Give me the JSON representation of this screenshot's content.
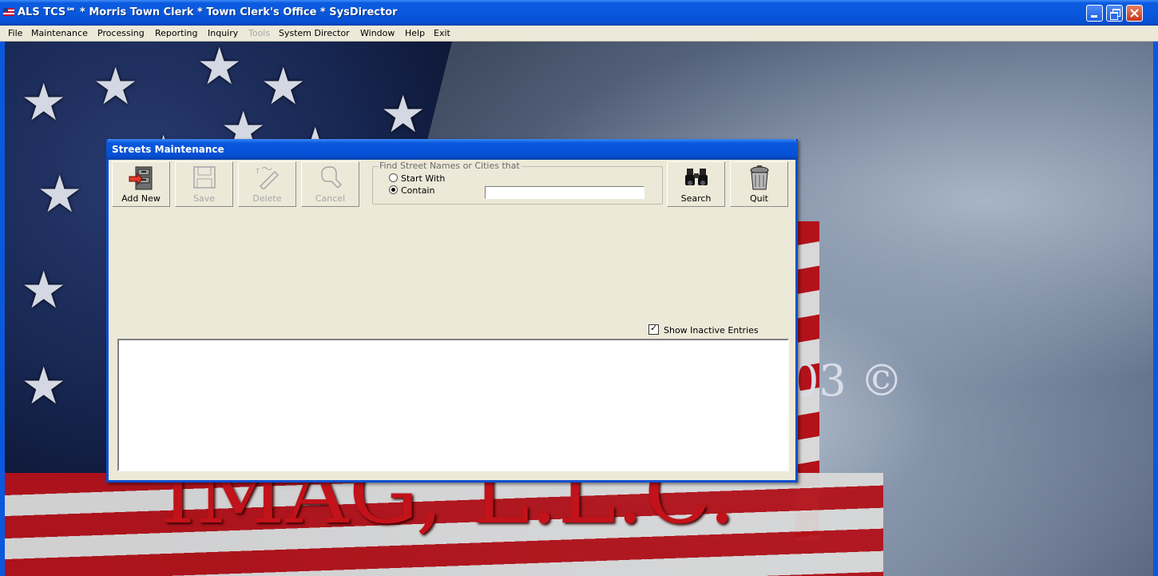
{
  "window": {
    "title": "ALS TCS℠ * Morris Town Clerk * Town Clerk's Office * SysDirector",
    "colors": {
      "titlebar": "#0a58dd",
      "close": "#c4371c"
    }
  },
  "menu": [
    {
      "label": "File"
    },
    {
      "label": "Maintenance"
    },
    {
      "label": "Processing"
    },
    {
      "label": "Reporting"
    },
    {
      "label": "Inquiry"
    },
    {
      "label": "Tools",
      "disabled": true
    },
    {
      "label": "System Director"
    },
    {
      "label": "Window"
    },
    {
      "label": "Help"
    },
    {
      "label": "Exit"
    }
  ],
  "background": {
    "text_main": "IMAG, L.L.C.",
    "text_copy": "03 ©"
  },
  "dialog": {
    "title": "Streets Maintenance",
    "toolbar": {
      "add_new": "Add New",
      "save": "Save",
      "delete": "Delete",
      "cancel": "Cancel",
      "search": "Search",
      "quit": "Quit"
    },
    "find": {
      "legend": "Find Street Names or Cities that",
      "option_start": "Start With",
      "option_contain": "Contain",
      "selected": "Contain",
      "value": ""
    },
    "show_inactive": {
      "label": "Show Inactive Entries",
      "checked": true
    }
  }
}
